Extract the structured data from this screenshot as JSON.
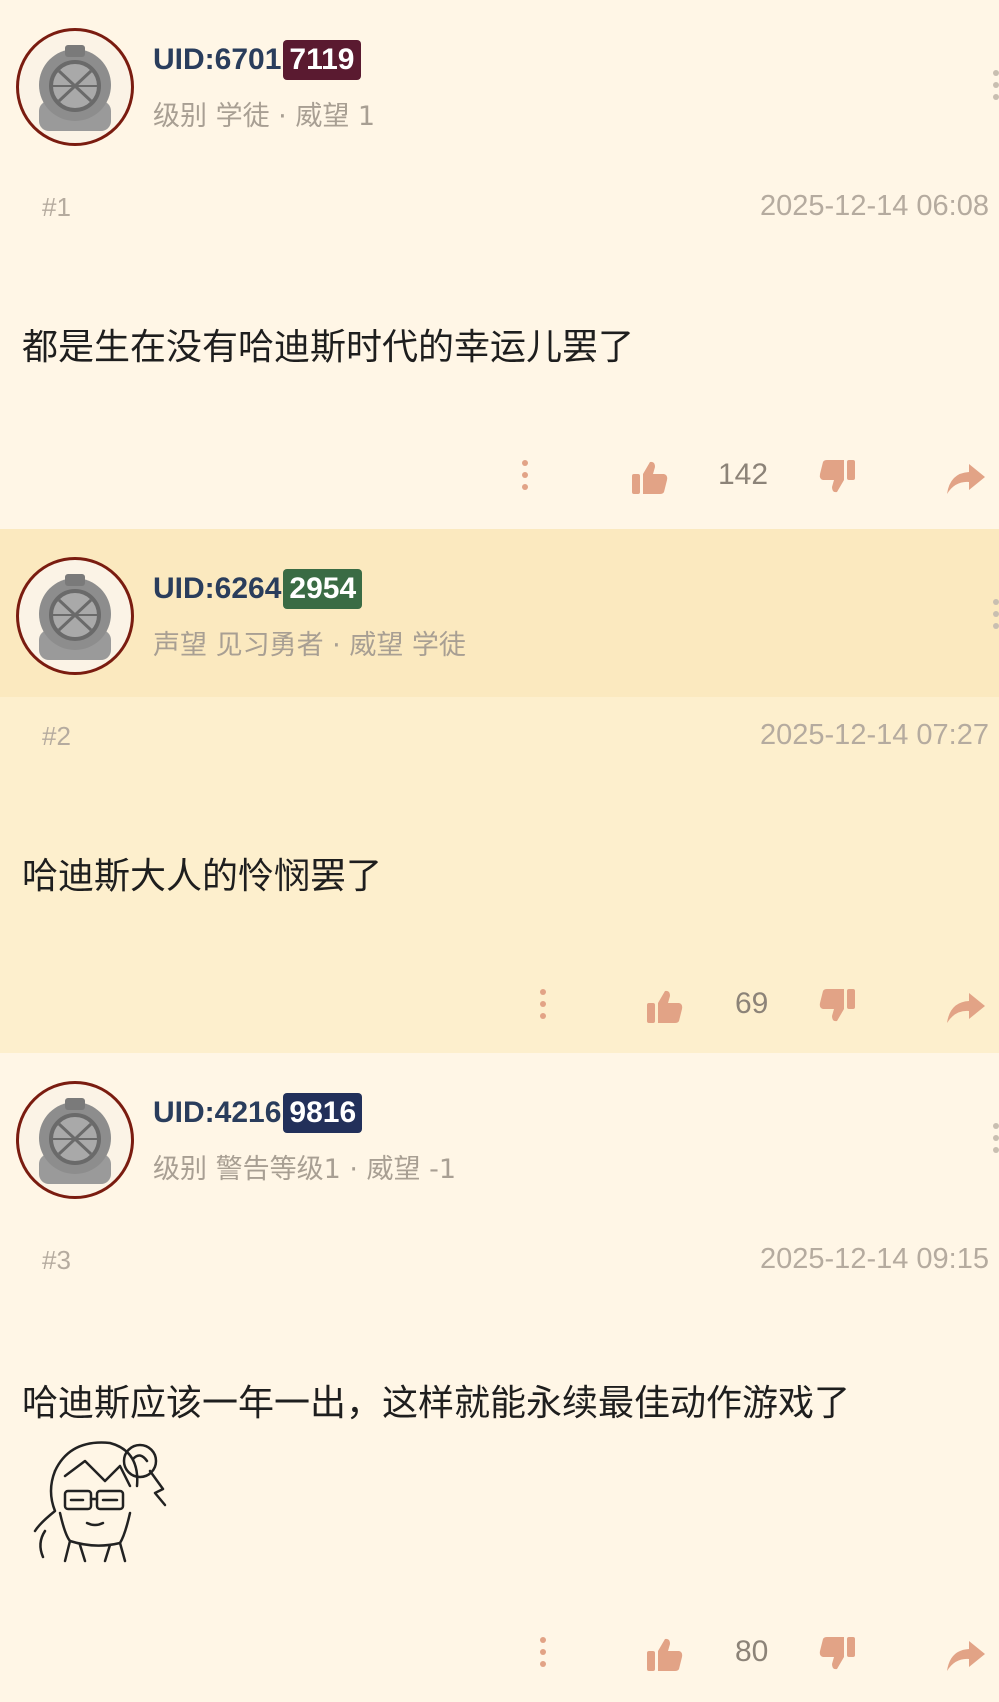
{
  "posts": [
    {
      "uid_prefix": "UID:6701",
      "uid_suffix": "7119",
      "badge_color": "#5a1a30",
      "meta": "级别 学徒 · 威望 1",
      "floor": "#1",
      "date": "2025-12-14 06:08",
      "content": "都是生在没有哈迪斯时代的幸运儿罢了",
      "likes": "142"
    },
    {
      "uid_prefix": "UID:6264",
      "uid_suffix": "2954",
      "badge_color": "#3a6b44",
      "meta": "声望 见习勇者 · 威望 学徒",
      "floor": "#2",
      "date": "2025-12-14 07:27",
      "content": "哈迪斯大人的怜悯罢了",
      "likes": "69"
    },
    {
      "uid_prefix": "UID:4216",
      "uid_suffix": "9816",
      "badge_color": "#22305a",
      "meta": "级别 警告等级1 · 威望 -1",
      "floor": "#3",
      "date": "2025-12-14 09:15",
      "content": "哈迪斯应该一年一出，这样就能永续最佳动作游戏了",
      "likes": "80"
    }
  ],
  "icons": {
    "like": "thumbs-up-icon",
    "dislike": "thumbs-down-icon",
    "share": "share-icon",
    "more": "more-vertical-icon",
    "avatar": "diving-helmet-avatar"
  },
  "colors": {
    "icon": "#e2a386",
    "uid_text": "#2a3d5c",
    "avatar_border": "#7a1c10"
  }
}
